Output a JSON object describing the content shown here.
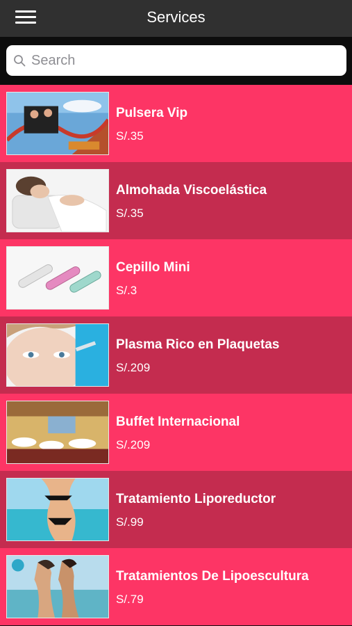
{
  "header": {
    "title": "Services",
    "menu_icon": "hamburger-menu-icon"
  },
  "search": {
    "placeholder": "Search",
    "value": "",
    "icon": "search-icon"
  },
  "colors": {
    "row_light": "#fd3565",
    "row_dark": "#c42c4f",
    "navbar": "#303030"
  },
  "services": [
    {
      "name": "Pulsera Vip",
      "price": "S/.35"
    },
    {
      "name": "Almohada Viscoelástica",
      "price": "S/.35"
    },
    {
      "name": "Cepillo Mini",
      "price": "S/.3"
    },
    {
      "name": "Plasma Rico en Plaquetas",
      "price": "S/.209"
    },
    {
      "name": "Buffet Internacional",
      "price": "S/.209"
    },
    {
      "name": "Tratamiento Liporeductor",
      "price": "S/.99"
    },
    {
      "name": "Tratamientos De Lipoescultura",
      "price": "S/.79"
    }
  ]
}
